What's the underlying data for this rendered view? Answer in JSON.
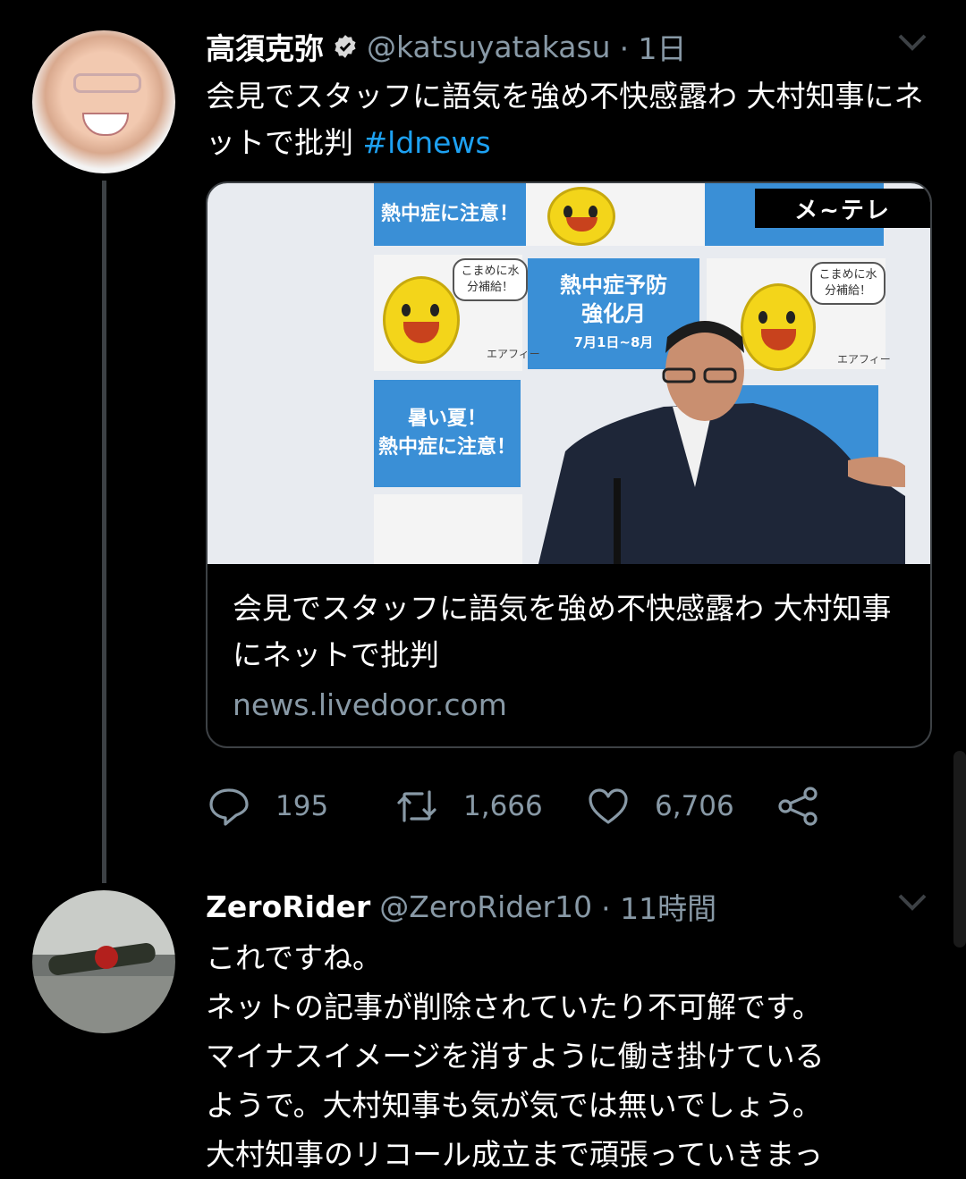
{
  "tweet1": {
    "name": "高須克弥",
    "handle": "@katsuyatakasu",
    "time": "· 1日",
    "text": "会見でスタッフに語気を強め不快感露わ 大村知事にネットで批判 ",
    "hashtag": "#ldnews",
    "card": {
      "logo": "メ~テレ",
      "poster_top": "熱中症に注意！",
      "poster_center_line1": "熱中症予防",
      "poster_center_line2": "強化月",
      "poster_center_line3": "7月1日~8月",
      "poster_bottom_line1": "暑い夏！",
      "poster_bottom_line2": "熱中症に注意！",
      "speech": "こまめに水分補給！",
      "mascot_label": "エアフィー",
      "title": "会見でスタッフに語気を強め不快感露わ 大村知事にネットで批判",
      "domain": "news.livedoor.com"
    },
    "actions": {
      "replies": "195",
      "retweets": "1,666",
      "likes": "6,706"
    }
  },
  "tweet2": {
    "name": "ZeroRider",
    "handle": "@ZeroRider10",
    "time": "· 11時間",
    "lines": [
      "これですね。",
      "ネットの記事が削除されていたり不可解です。",
      "マイナスイメージを消すように働き掛けている",
      "ようで。大村知事も気が気では無いでしょう。",
      "大村知事のリコール成立まで頑張っていきまっ"
    ]
  },
  "colors": {
    "background": "#000000",
    "secondary_text": "#8899a6",
    "link": "#1da1f2",
    "divider": "#3d4145"
  }
}
